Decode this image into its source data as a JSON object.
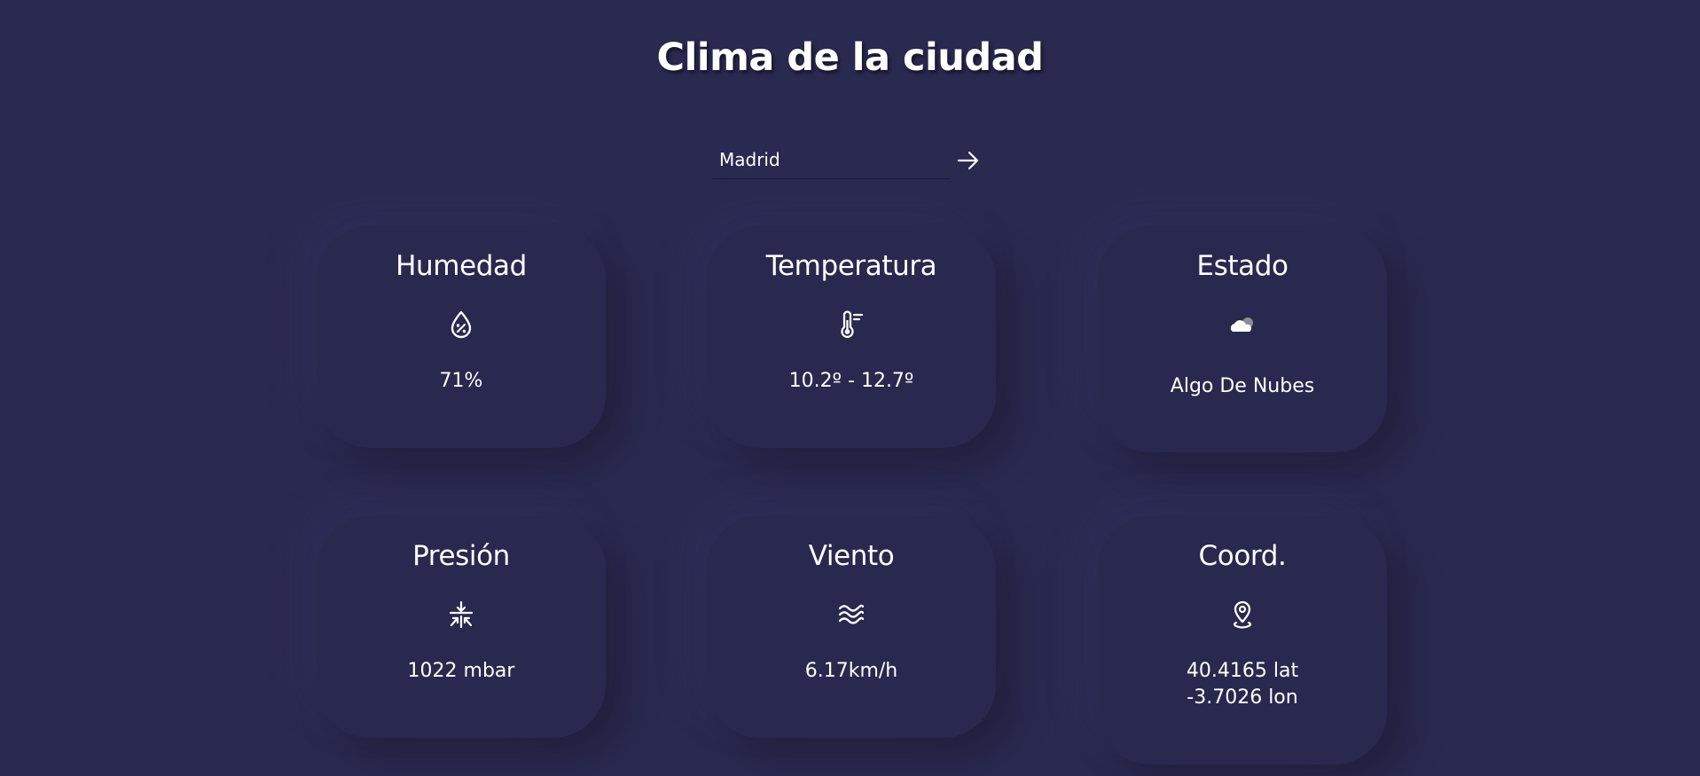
{
  "header": {
    "title": "Clima de la ciudad"
  },
  "search": {
    "value": "Madrid",
    "submit_icon": "arrow-right-icon"
  },
  "cards": [
    {
      "title": "Humedad",
      "icon": "humidity-drop-icon",
      "value": "71%"
    },
    {
      "title": "Temperatura",
      "icon": "thermometer-icon",
      "value": "10.2º - 12.7º"
    },
    {
      "title": "Estado",
      "icon": "cloud-icon",
      "value": "Algo De Nubes"
    },
    {
      "title": "Presión",
      "icon": "pressure-icon",
      "value": "1022 mbar"
    },
    {
      "title": "Viento",
      "icon": "wind-waves-icon",
      "value": "6.17km/h"
    },
    {
      "title": "Coord.",
      "icon": "location-pin-icon",
      "lat": "40.4165 lat",
      "lon": "-3.7026 lon"
    }
  ],
  "colors": {
    "background": "#2a2950",
    "card": "#29284e",
    "text": "#ffffff"
  }
}
